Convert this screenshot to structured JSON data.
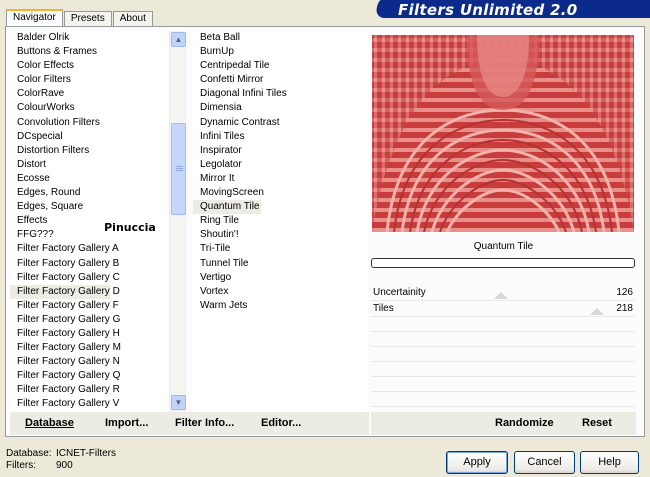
{
  "tabs": [
    {
      "label": "Navigator",
      "active": true
    },
    {
      "label": "Presets",
      "active": false
    },
    {
      "label": "About",
      "active": false
    }
  ],
  "title": "Filters Unlimited 2.0",
  "categories": [
    "Balder Olrik",
    "Buttons & Frames",
    "Color Effects",
    "Color Filters",
    "ColorRave",
    "ColourWorks",
    "Convolution Filters",
    "DCspecial",
    "Distortion Filters",
    "Distort",
    "Ecosse",
    "Edges, Round",
    "Edges, Square",
    "Effects",
    "FFG???",
    "Filter Factory Gallery A",
    "Filter Factory Gallery B",
    "Filter Factory Gallery C",
    "Filter Factory Gallery D",
    "Filter Factory Gallery F",
    "Filter Factory Gallery G",
    "Filter Factory Gallery H",
    "Filter Factory Gallery M",
    "Filter Factory Gallery N",
    "Filter Factory Gallery Q",
    "Filter Factory Gallery R",
    "Filter Factory Gallery V"
  ],
  "selected_category": "Filter Factory Gallery D",
  "filters": [
    "Beta Ball",
    "BurnUp",
    "Centripedal Tile",
    "Confetti Mirror",
    "Diagonal Infini Tiles",
    "Dimensia",
    "Dynamic Contrast",
    "Infini Tiles",
    "Inspirator",
    "Legolator",
    "Mirror It",
    "MovingScreen",
    "Quantum Tile",
    "Ring Tile",
    "Shoutin'!",
    "Tri-Tile",
    "Tunnel Tile",
    "Vertigo",
    "Vortex",
    "Warm Jets"
  ],
  "selected_filter": "Quantum Tile",
  "watermark": "Pinuccia",
  "preview": {
    "filter_name": "Quantum Tile",
    "colors": {
      "dark": "#c83c3c",
      "light": "#e88a86"
    }
  },
  "progress": 0,
  "params": [
    {
      "name": "Uncertainity",
      "value": "126",
      "fraction": 0.494
    },
    {
      "name": "Tiles",
      "value": "218",
      "fraction": 0.855
    }
  ],
  "buttons_left": {
    "database": "Database",
    "import": "Import...",
    "filter_info": "Filter Info...",
    "editor": "Editor..."
  },
  "buttons_right": {
    "randomize": "Randomize",
    "reset": "Reset"
  },
  "status": {
    "database_label": "Database:",
    "database_value": "ICNET-Filters",
    "filters_label": "Filters:",
    "filters_value": "900"
  },
  "dialog_buttons": {
    "apply": "Apply",
    "cancel": "Cancel",
    "help": "Help"
  }
}
